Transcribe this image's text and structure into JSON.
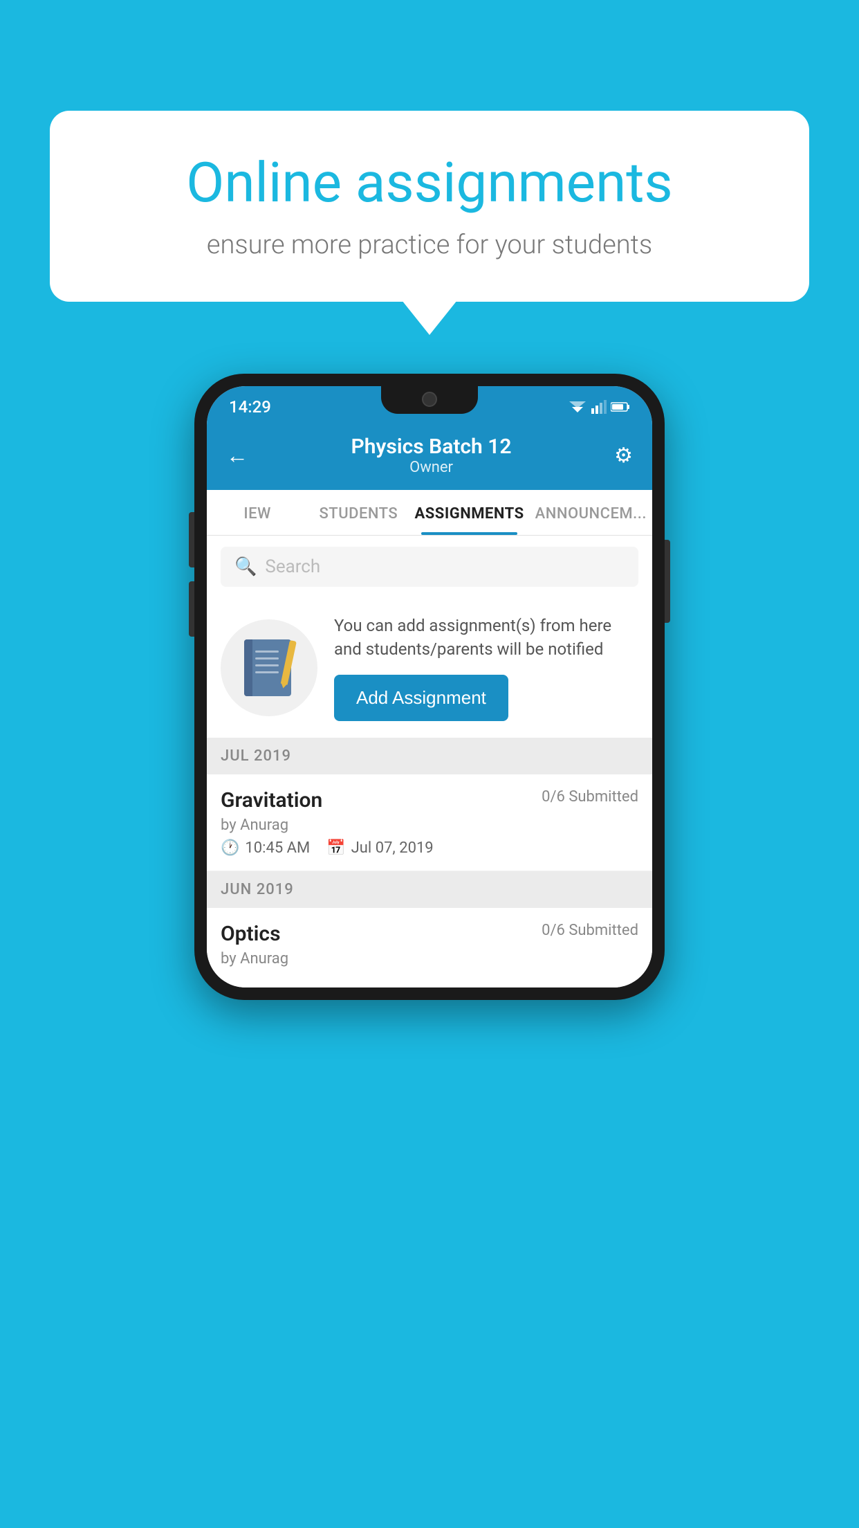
{
  "background_color": "#1BB8E0",
  "speech_bubble": {
    "title": "Online assignments",
    "subtitle": "ensure more practice for your students"
  },
  "phone": {
    "status_bar": {
      "time": "14:29"
    },
    "header": {
      "title": "Physics Batch 12",
      "subtitle": "Owner",
      "back_icon": "←",
      "settings_icon": "⚙"
    },
    "tabs": [
      {
        "label": "IEW",
        "active": false
      },
      {
        "label": "STUDENTS",
        "active": false
      },
      {
        "label": "ASSIGNMENTS",
        "active": true
      },
      {
        "label": "ANNOUNCEM...",
        "active": false
      }
    ],
    "search": {
      "placeholder": "Search"
    },
    "promo": {
      "description": "You can add assignment(s) from here and students/parents will be notified",
      "button_label": "Add Assignment"
    },
    "sections": [
      {
        "month": "JUL 2019",
        "assignments": [
          {
            "name": "Gravitation",
            "submitted": "0/6 Submitted",
            "by": "by Anurag",
            "time": "10:45 AM",
            "date": "Jul 07, 2019"
          }
        ]
      },
      {
        "month": "JUN 2019",
        "assignments": [
          {
            "name": "Optics",
            "submitted": "0/6 Submitted",
            "by": "by Anurag",
            "time": "",
            "date": ""
          }
        ]
      }
    ]
  }
}
